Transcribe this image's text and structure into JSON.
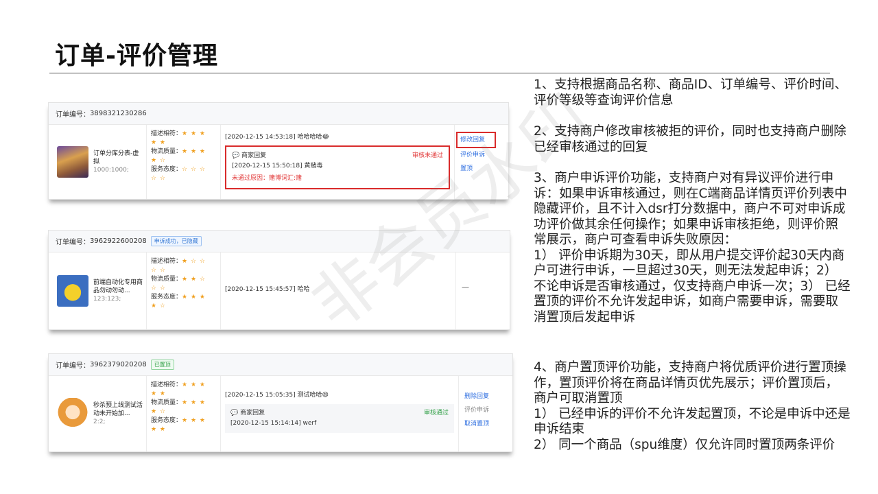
{
  "slide": {
    "title": "订单-评价管理",
    "watermark": "非会员水印"
  },
  "labels": {
    "order_prefix": "订单编号：",
    "rating_desc": "描述相符：",
    "rating_logistics": "物流质量：",
    "rating_service": "服务态度：",
    "merchant_reply": "商家回复"
  },
  "cards": [
    {
      "order_no": "3898321230286",
      "product_name": "订单分库分表-虚拟",
      "product_meta": "1000:1000;",
      "ratings": [
        {
          "stars": "★ ★ ★",
          "stars2": "★ ★",
          "value": 5
        },
        {
          "stars": "★ ★ ★",
          "stars2": "★ ☆",
          "value": 4
        },
        {
          "stars": "☆ ☆ ☆",
          "stars2": "☆ ☆",
          "value": 0
        }
      ],
      "comment": "[2020-12-15 14:53:18] 哈哈哈哈😂",
      "reply_time_text": "[2020-12-15 15:50:18] 黄赌毒",
      "reply_status": "审核未通过",
      "reject_reason": "未通过原因：赌博词汇:赌",
      "actions": [
        "修改回复",
        "评价申诉",
        "置顶"
      ]
    },
    {
      "order_no": "3962922600208",
      "tag": "申诉成功，已隐藏",
      "product_name": "前端自动化专用商品勿动勿动...",
      "product_meta": "123:123;",
      "ratings": [
        {
          "stars": "★ ☆ ☆",
          "stars2": "☆ ☆",
          "value": 1
        },
        {
          "stars": "★ ★ ☆",
          "stars2": "☆ ☆",
          "value": 2
        },
        {
          "stars": "★ ★ ★",
          "stars2": "★ ☆",
          "value": 4
        }
      ],
      "comment": "[2020-12-15 15:45:57] 哈哈",
      "action_placeholder": "—"
    },
    {
      "order_no": "3962379020208",
      "tag": "已置顶",
      "product_name": "秒杀预上线测试活动未开始加...",
      "product_meta": "2:2;",
      "ratings": [
        {
          "stars": "★ ★ ★",
          "stars2": "★ ★",
          "value": 5
        },
        {
          "stars": "★ ★ ★",
          "stars2": "★ ☆",
          "value": 4
        },
        {
          "stars": "★ ★ ★",
          "stars2": "★ ★",
          "value": 5
        }
      ],
      "comment": "[2020-12-15 15:05:35] 测试哈哈😄",
      "reply_time_text": "[2020-12-15 15:14:14] werf",
      "reply_status": "审核通过",
      "actions": [
        "删除回复",
        "评价申诉",
        "取消置顶"
      ]
    }
  ],
  "description": {
    "p1": "1、支持根据商品名称、商品ID、订单编号、评价时间、评价等级等查询评价信息",
    "p2": "2、支持商户修改审核被拒的评价，同时也支持商户删除已经审核通过的回复",
    "p3": "3、商户申诉评价功能，支持商户对有异议评价进行申诉：如果申诉审核通过，则在C端商品详情页评价列表中隐藏评价，且不计入dsr打分数据中，商户不可对申诉成功评价做其余任何操作；如果申诉审核拒绝，则评价照常展示，商户可查看申诉失败原因：\n1） 评价申诉期为30天，即从用户提交评价起30天内商户可进行申诉，一旦超过30天，则无法发起申诉；2） 不论申诉是否审核通过，仅支持商户申诉一次；3） 已经置顶的评价不允许发起申诉，如商户需要申诉，需要取消置顶后发起申诉",
    "p4": "4、商户置顶评价功能，支持商户将优质评价进行置顶操作，置顶评价将在商品详情页优先展示；评价置顶后，商户可取消置顶\n1） 已经申诉的评价不允许发起置顶，不论是申诉中还是申诉结束\n2） 同一个商品（spu维度）仅允许同时置顶两条评价"
  }
}
